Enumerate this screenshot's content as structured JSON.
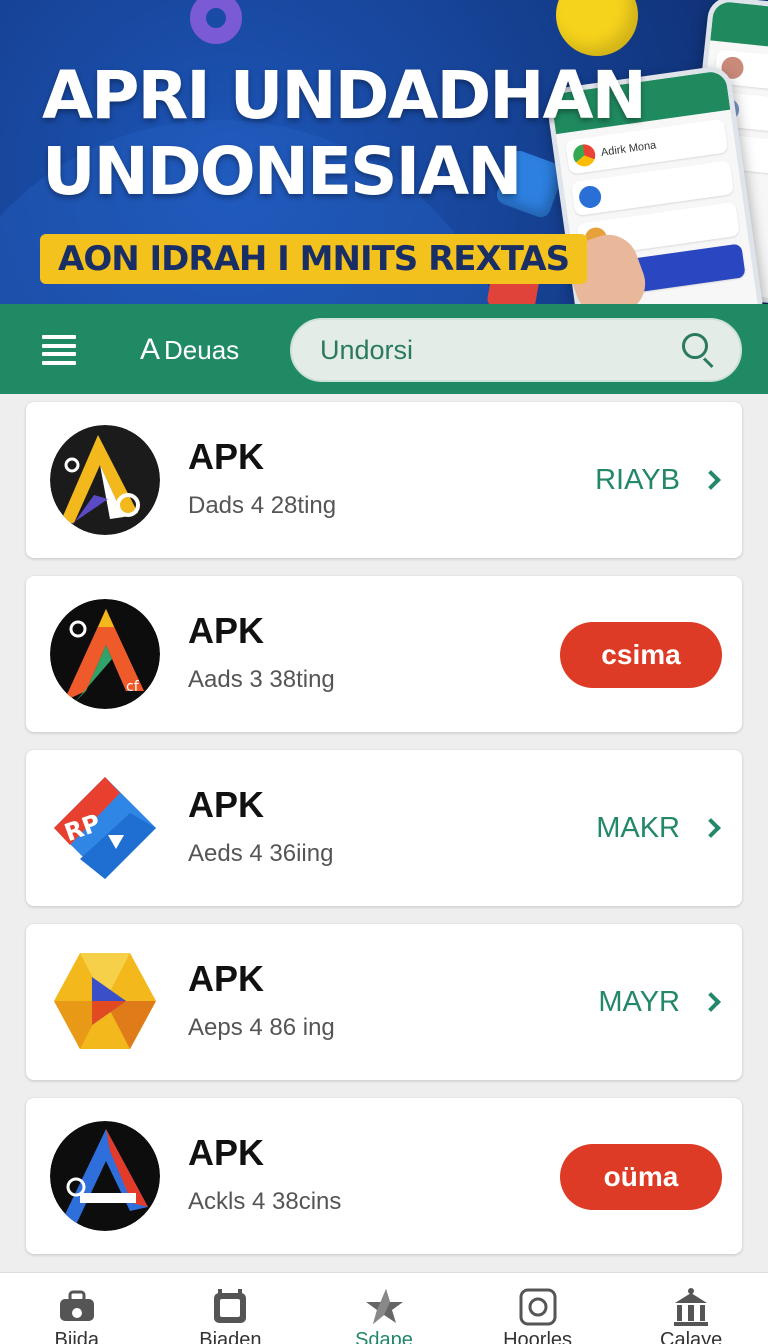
{
  "banner": {
    "title_line1": "APRI UNDADHAN",
    "title_line2": "UNDONESIAN",
    "tagline": "AON IDRAH I MNITS REXTAS",
    "phone_items": [
      "Adirk Mona"
    ]
  },
  "header": {
    "menu_icon": "hamburger-icon",
    "brand_icon": "A",
    "brand_name": "Deuas",
    "search_value": "Undorsi",
    "search_icon": "search-icon"
  },
  "apps": [
    {
      "title": "APK",
      "subtitle": "Dads  4  28ting",
      "action_type": "link",
      "action_label": "RIAYB"
    },
    {
      "title": "APK",
      "subtitle": "Aads  3  38ting",
      "action_type": "button",
      "action_label": "csima"
    },
    {
      "title": "APK",
      "subtitle": "Aeds  4  36iing",
      "action_type": "link",
      "action_label": "MAKR"
    },
    {
      "title": "APK",
      "subtitle": "Aeps  4  86 ing",
      "action_type": "link",
      "action_label": "MAYR"
    },
    {
      "title": "APK",
      "subtitle": "Ackls  4  38cins",
      "action_type": "button",
      "action_label": "oüma"
    }
  ],
  "bottom_nav": {
    "active_index": 2,
    "items": [
      {
        "label": "Biida",
        "icon": "bag-icon"
      },
      {
        "label": "Biaden",
        "icon": "film-icon"
      },
      {
        "label": "Sdape",
        "icon": "star-icon"
      },
      {
        "label": "Hoorles",
        "icon": "camera-icon"
      },
      {
        "label": "Calaye",
        "icon": "building-icon"
      }
    ]
  },
  "colors": {
    "brand_green": "#208a65",
    "accent_red": "#dd3b25",
    "banner_blue": "#17459a",
    "tag_yellow": "#f4c21c"
  }
}
